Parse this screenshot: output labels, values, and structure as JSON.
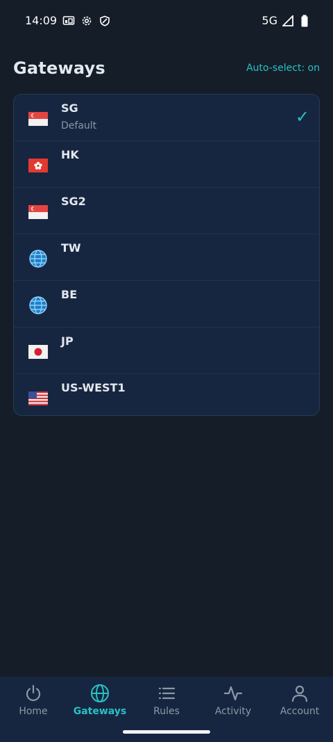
{
  "status_bar": {
    "time": "14:09",
    "network": "5G",
    "left_icons": [
      "cast-icon",
      "settings-icon",
      "shield-icon"
    ],
    "right_icons": [
      "signal-icon",
      "battery-icon"
    ]
  },
  "header": {
    "title": "Gateways",
    "auto_select": "Auto-select: on"
  },
  "gateways": [
    {
      "name": "SG",
      "subtitle": "Default",
      "flag": "singapore-flag-icon",
      "selected": true
    },
    {
      "name": "HK",
      "subtitle": "",
      "flag": "hong-kong-flag-icon",
      "selected": false
    },
    {
      "name": "SG2",
      "subtitle": "",
      "flag": "singapore-flag-icon",
      "selected": false
    },
    {
      "name": "TW",
      "subtitle": "",
      "flag": "globe-icon",
      "selected": false
    },
    {
      "name": "BE",
      "subtitle": "",
      "flag": "globe-icon",
      "selected": false
    },
    {
      "name": "JP",
      "subtitle": "",
      "flag": "japan-flag-icon",
      "selected": false
    },
    {
      "name": "US-WEST1",
      "subtitle": "",
      "flag": "usa-flag-icon",
      "selected": false
    }
  ],
  "check_mark": "✓",
  "bottom_nav": {
    "items": [
      {
        "label": "Home",
        "icon": "power-icon",
        "active": false
      },
      {
        "label": "Gateways",
        "icon": "globe-icon",
        "active": true
      },
      {
        "label": "Rules",
        "icon": "list-icon",
        "active": false
      },
      {
        "label": "Activity",
        "icon": "activity-icon",
        "active": false
      },
      {
        "label": "Account",
        "icon": "account-icon",
        "active": false
      }
    ]
  },
  "colors": {
    "background": "#151d28",
    "card": "#172640",
    "accent": "#27c2c6",
    "muted": "#8d98a8"
  }
}
